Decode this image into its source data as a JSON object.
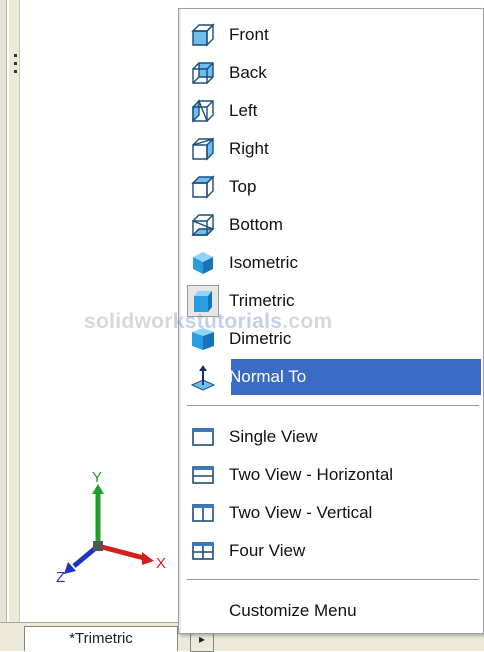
{
  "menu": {
    "view_items": [
      {
        "label": "Front",
        "icon": "front-view-icon"
      },
      {
        "label": "Back",
        "icon": "back-view-icon"
      },
      {
        "label": "Left",
        "icon": "left-view-icon"
      },
      {
        "label": "Right",
        "icon": "right-view-icon"
      },
      {
        "label": "Top",
        "icon": "top-view-icon"
      },
      {
        "label": "Bottom",
        "icon": "bottom-view-icon"
      },
      {
        "label": "Isometric",
        "icon": "isometric-view-icon"
      },
      {
        "label": "Trimetric",
        "icon": "trimetric-view-icon",
        "checked": true
      },
      {
        "label": "Dimetric",
        "icon": "dimetric-view-icon"
      },
      {
        "label": "Normal To",
        "icon": "normal-to-icon",
        "selected": true
      }
    ],
    "viewport_items": [
      {
        "label": "Single View",
        "icon": "single-view-icon"
      },
      {
        "label": "Two View - Horizontal",
        "icon": "two-view-horizontal-icon"
      },
      {
        "label": "Two View - Vertical",
        "icon": "two-view-vertical-icon"
      },
      {
        "label": "Four View",
        "icon": "four-view-icon"
      }
    ],
    "customize_label": "Customize Menu"
  },
  "watermark": {
    "part1": "solidwor",
    "part2": "kstutorials",
    "part3": ".com"
  },
  "triad": {
    "x_label": "X",
    "y_label": "Y",
    "z_label": "Z"
  },
  "tab": {
    "label": "*Trimetric",
    "arrow": "▸"
  },
  "colors": {
    "selection": "#3a6bc5",
    "cube_blue": "#2a9be0",
    "triad_x": "#d22020",
    "triad_y": "#1f9e2a",
    "triad_z": "#1f33c2"
  }
}
